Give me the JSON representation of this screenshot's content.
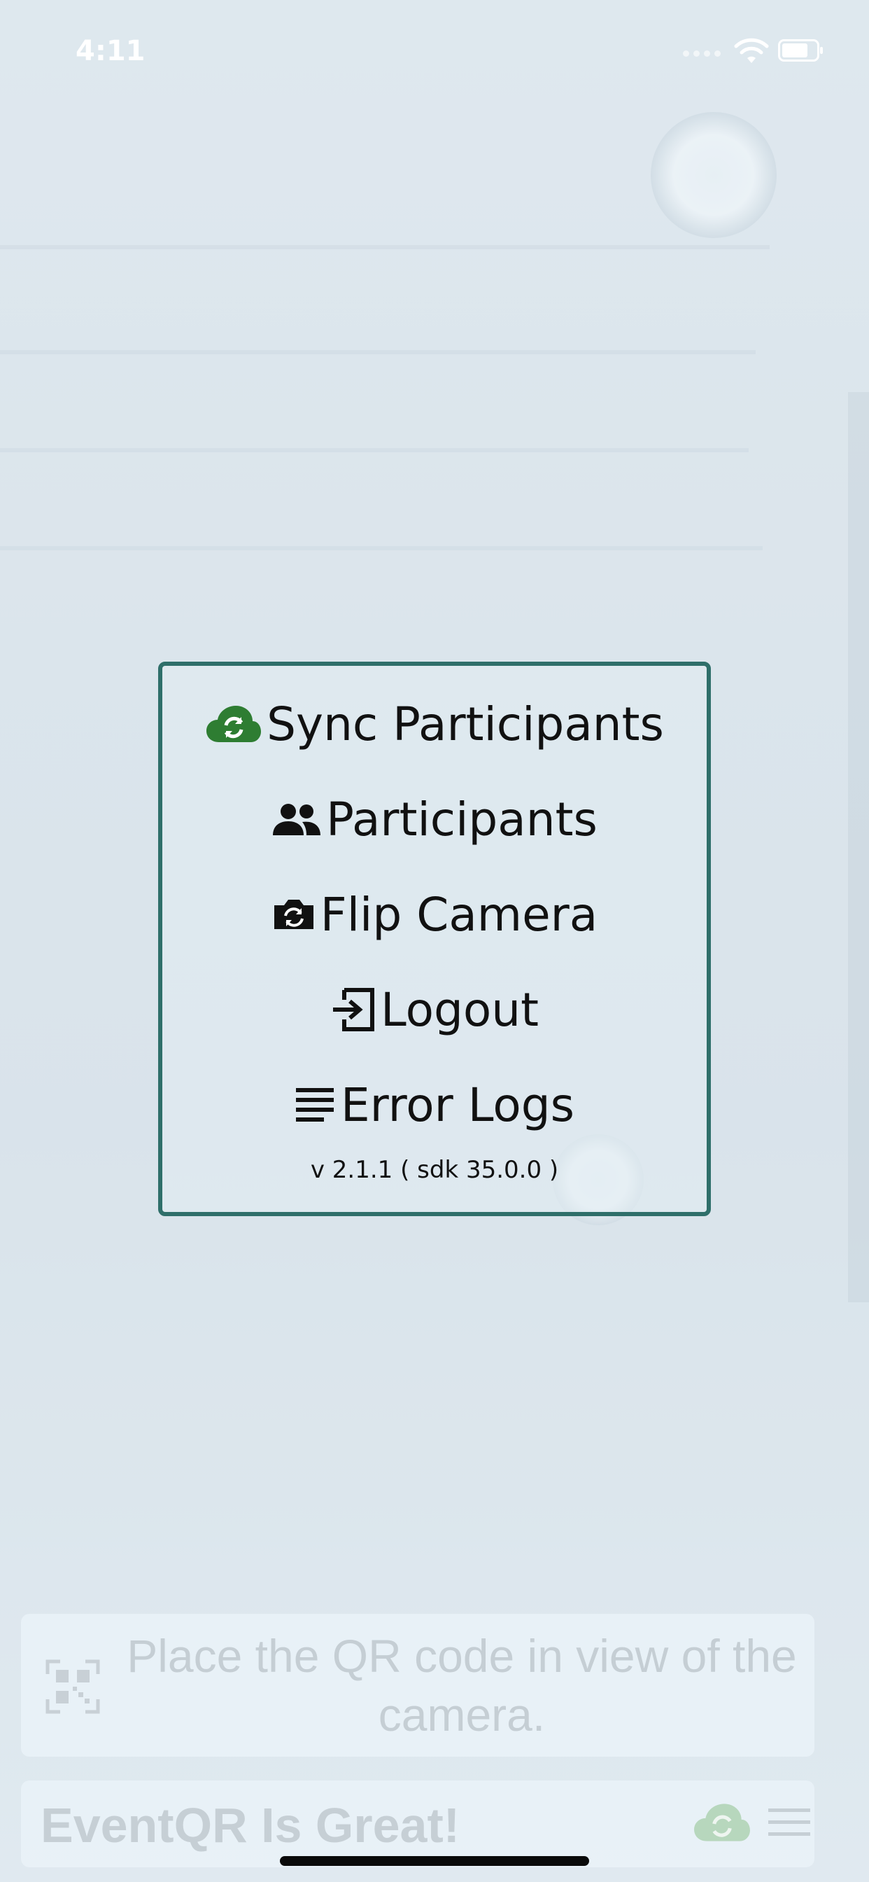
{
  "status_bar": {
    "time": "4:11"
  },
  "menu": {
    "items": [
      {
        "label": "Sync Participants",
        "icon": "cloud-sync-icon"
      },
      {
        "label": "Participants",
        "icon": "people-icon"
      },
      {
        "label": "Flip Camera",
        "icon": "camera-flip-icon"
      },
      {
        "label": "Logout",
        "icon": "logout-icon"
      },
      {
        "label": "Error Logs",
        "icon": "list-lines-icon"
      }
    ],
    "version": "v 2.1.1 ( sdk 35.0.0 )",
    "border_color": "#2f6f6a",
    "sync_icon_color": "#2e7d32"
  },
  "scanner": {
    "hint": "Place the QR code in view of the camera.",
    "icon": "qr-code-icon"
  },
  "bottom_bar": {
    "title": "EventQR Is Great!",
    "sync_icon": "cloud-sync-icon",
    "menu_icon": "menu-icon"
  }
}
